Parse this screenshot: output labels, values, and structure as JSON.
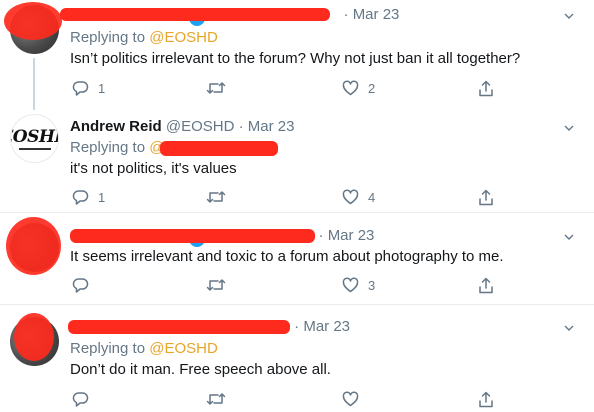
{
  "colors": {
    "accent": "#1da1f2",
    "mention": "#e8a52a",
    "muted": "#657786",
    "redaction": "#ff2a1e"
  },
  "icons": [
    "reply-icon",
    "retweet-icon",
    "like-icon",
    "share-icon",
    "chevron-down-icon",
    "verified-badge-icon"
  ],
  "tweets": [
    {
      "date": "Mar 23",
      "replying_label": "Replying to",
      "replying_handle": "@EOSHD",
      "text": "Isn’t politics irrelevant to the forum? Why not just ban it all together?",
      "reply_count": "1",
      "like_count": "2"
    },
    {
      "name": "Andrew Reid",
      "handle": "@EOSHD",
      "date": "Mar 23",
      "avatar_text": "EOSHD",
      "replying_label": "Replying to",
      "replying_handle": "@",
      "text": "it's not politics, it's values",
      "reply_count": "1",
      "like_count": "4"
    },
    {
      "date": "Mar 23",
      "text": "It seems irrelevant and toxic to a forum about photography to me.",
      "like_count": "3"
    },
    {
      "date": "Mar 23",
      "replying_label": "Replying to",
      "replying_handle": "@EOSHD",
      "text": "Don’t do it man. Free speech above all."
    }
  ]
}
